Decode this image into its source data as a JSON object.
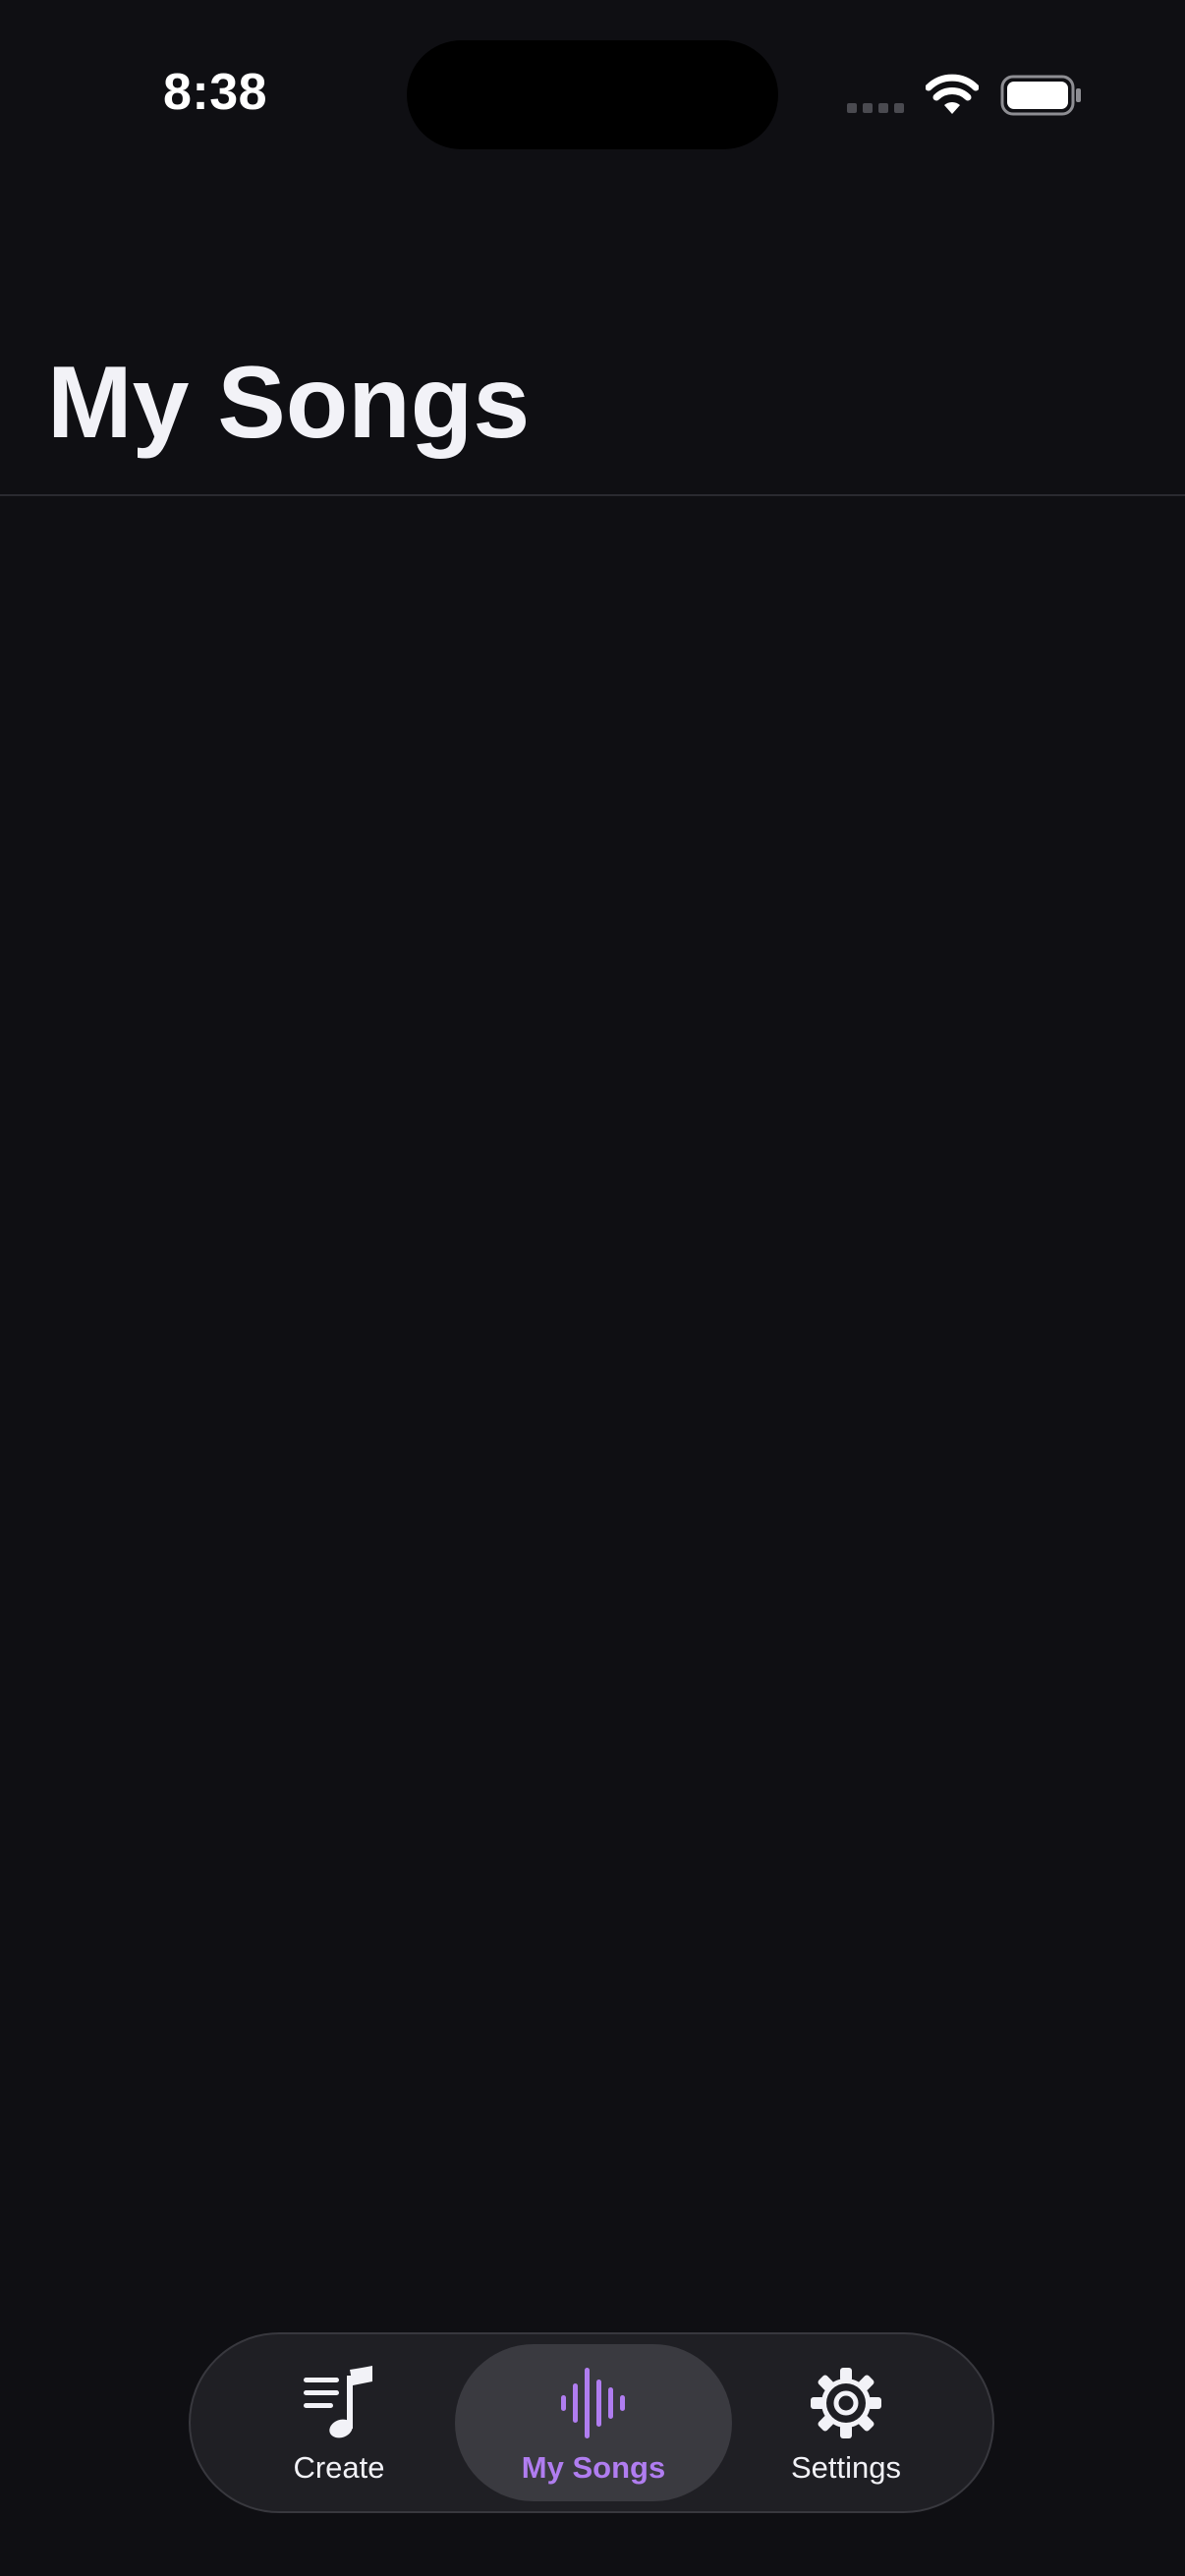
{
  "status_bar": {
    "time": "8:38",
    "icons": [
      "signal-icon",
      "wifi-icon",
      "battery-icon"
    ]
  },
  "header": {
    "title": "My Songs"
  },
  "tab_bar": {
    "tabs": [
      {
        "label": "Create",
        "icon": "music-lyrics-icon",
        "selected": false
      },
      {
        "label": "My Songs",
        "icon": "waveform-icon",
        "selected": true
      },
      {
        "label": "Settings",
        "icon": "gear-icon",
        "selected": false
      }
    ]
  },
  "colors": {
    "background": "#0f0f13",
    "accent": "#b07df0",
    "tab_bar_bg": "#1f1f24",
    "selected_tab_bg": "#3a3a40",
    "text": "#f2f2f7"
  }
}
